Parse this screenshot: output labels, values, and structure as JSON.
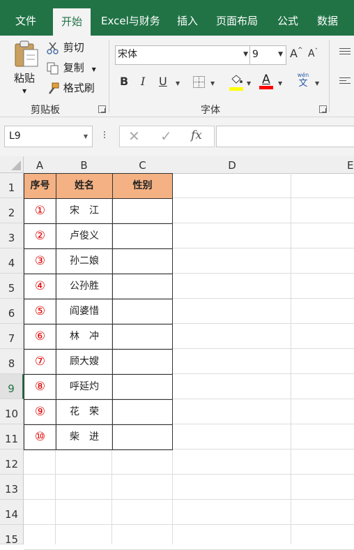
{
  "ribbon_tabs": [
    "文件",
    "开始",
    "Excel与财务",
    "插入",
    "页面布局",
    "公式",
    "数据"
  ],
  "active_tab": "开始",
  "clipboard": {
    "paste_label": "粘贴",
    "cut_label": "剪切",
    "copy_label": "复制",
    "format_painter_label": "格式刷",
    "group_label": "剪贴板"
  },
  "font": {
    "font_name": "宋体",
    "font_size": "9",
    "bold": "B",
    "italic": "I",
    "underline": "U",
    "font_color_letter": "A",
    "phonetic_top": "wén",
    "phonetic_bottom": "文",
    "grow_label": "A",
    "shrink_label": "A",
    "group_label": "字体"
  },
  "formula_bar": {
    "name_box": "L9",
    "fx_label": "fx",
    "formula": ""
  },
  "columns": [
    "A",
    "B",
    "C",
    "D",
    "E"
  ],
  "rows": [
    "1",
    "2",
    "3",
    "4",
    "5",
    "6",
    "7",
    "8",
    "9",
    "10",
    "11",
    "12",
    "13",
    "14",
    "15"
  ],
  "selected_row": "9",
  "table": {
    "headers": [
      "序号",
      "姓名",
      "性别"
    ],
    "rows": [
      {
        "num": "①",
        "name": "宋　江",
        "gender": ""
      },
      {
        "num": "②",
        "name": "卢俊义",
        "gender": ""
      },
      {
        "num": "③",
        "name": "孙二娘",
        "gender": ""
      },
      {
        "num": "④",
        "name": "公孙胜",
        "gender": ""
      },
      {
        "num": "⑤",
        "name": "阎婆惜",
        "gender": ""
      },
      {
        "num": "⑥",
        "name": "林　冲",
        "gender": ""
      },
      {
        "num": "⑦",
        "name": "顾大嫂",
        "gender": ""
      },
      {
        "num": "⑧",
        "name": "呼延灼",
        "gender": ""
      },
      {
        "num": "⑨",
        "name": "花　荣",
        "gender": ""
      },
      {
        "num": "⑩",
        "name": "柴　进",
        "gender": ""
      }
    ]
  },
  "colors": {
    "ribbon_green": "#217346",
    "header_fill": "#f4b183",
    "number_red": "#e00000",
    "highlight_yellow": "#ffff00",
    "font_color_red": "#ff0000"
  }
}
